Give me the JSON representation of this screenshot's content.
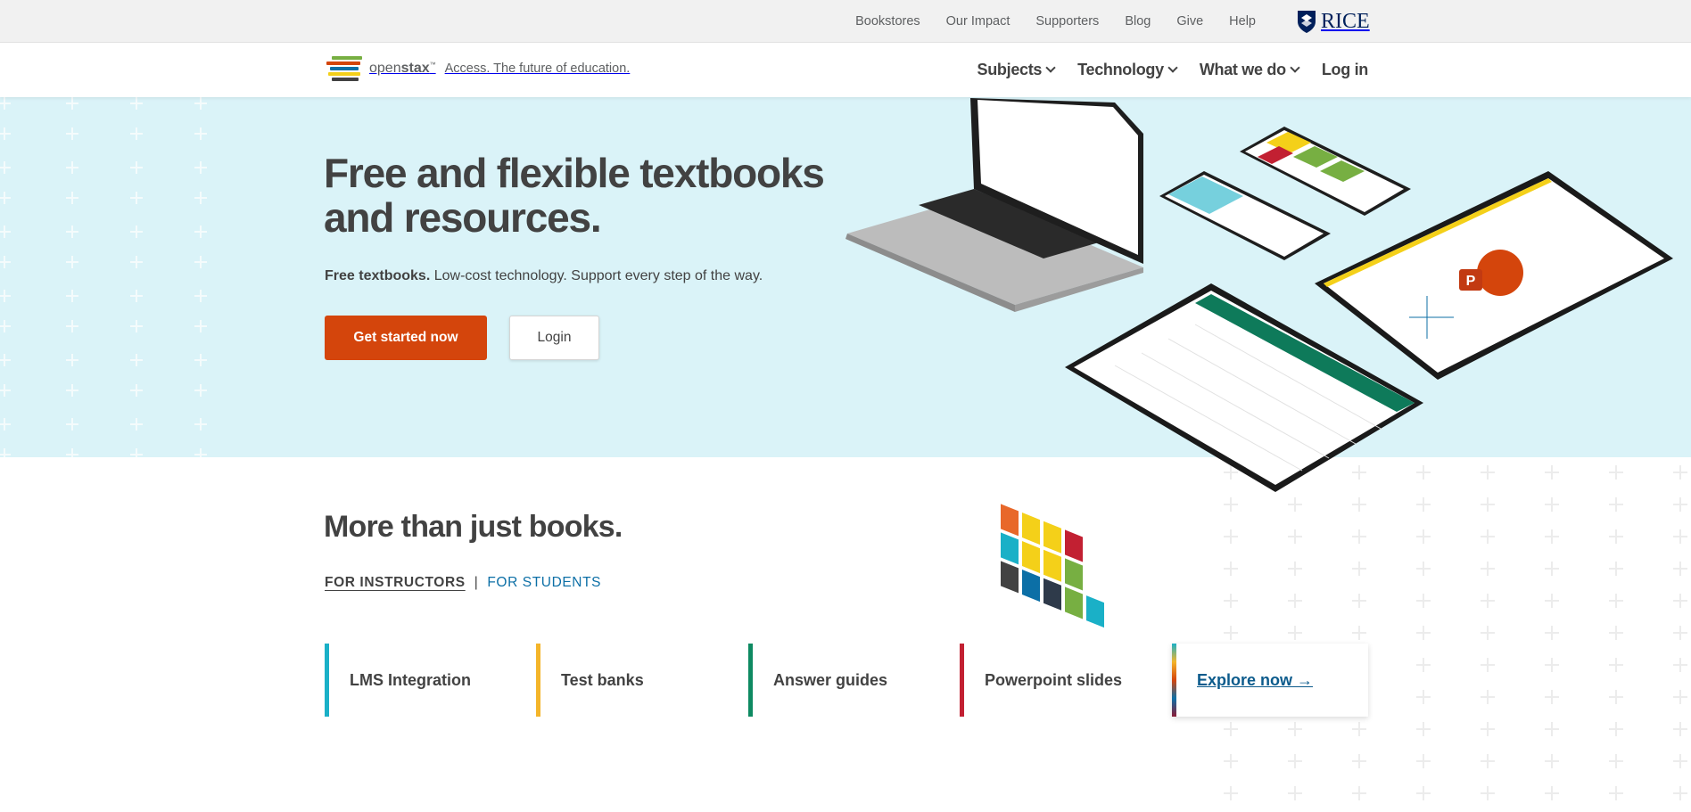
{
  "utility_bar": {
    "links": [
      "Bookstores",
      "Our Impact",
      "Supporters",
      "Blog",
      "Give",
      "Help"
    ],
    "rice_logo_text": "RICE"
  },
  "nav": {
    "logo_text_light": "open",
    "logo_text_bold": "stax",
    "tagline": "Access. The future of education.",
    "menu": [
      "Subjects",
      "Technology",
      "What we do"
    ],
    "login": "Log in"
  },
  "hero": {
    "title": "Free and flexible textbooks and resources.",
    "subtitle_bold": "Free textbooks.",
    "subtitle_rest": " Low-cost technology. Support every step of the way.",
    "primary_button": "Get started now",
    "secondary_button": "Login",
    "background_color": "#daf3f8",
    "accent_color": "#d4450c"
  },
  "resources_section": {
    "title": "More than just books.",
    "tabs": {
      "active": "FOR INSTRUCTORS",
      "separator": "|",
      "other": "FOR STUDENTS"
    },
    "items": [
      {
        "label": "LMS Integration",
        "color": "#1ab0c7"
      },
      {
        "label": "Test banks",
        "color": "#f4b52a"
      },
      {
        "label": "Answer guides",
        "color": "#0e8a62"
      },
      {
        "label": "Powerpoint slides",
        "color": "#c22032"
      }
    ],
    "explore_label": "Explore now →",
    "link_color": "#0c5b8c"
  }
}
